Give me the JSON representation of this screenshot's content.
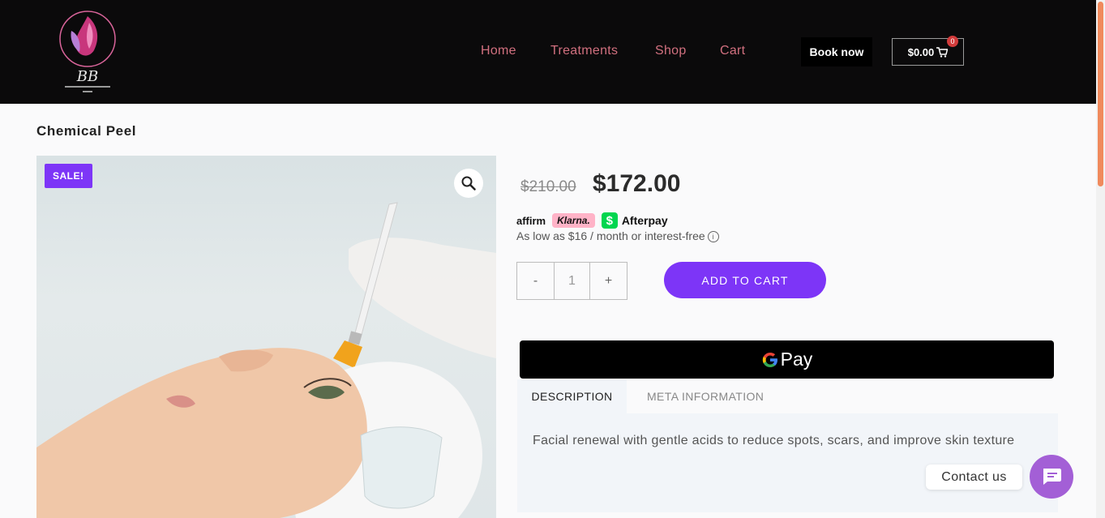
{
  "header": {
    "logo_text": "BB",
    "nav": [
      {
        "label": "Home"
      },
      {
        "label": "Treatments"
      },
      {
        "label": "Shop"
      },
      {
        "label": "Cart"
      }
    ],
    "book_now": "Book now",
    "cart_total": "$0.00",
    "cart_count": "0"
  },
  "product": {
    "title": "Chemical Peel",
    "sale_badge": "SALE!",
    "old_price": "$210.00",
    "price": "$172.00",
    "payment_logos": {
      "affirm": "affirm",
      "klarna": "Klarna.",
      "afterpay": "Afterpay"
    },
    "installment_text": "As low as $16 / month or interest-free",
    "quantity": "1",
    "qty_minus": "-",
    "qty_plus": "+",
    "add_to_cart": "ADD TO CART",
    "gpay_label": "Pay"
  },
  "tabs": [
    {
      "label": "DESCRIPTION",
      "active": true
    },
    {
      "label": "META INFORMATION",
      "active": false
    }
  ],
  "description": "Facial renewal with gentle acids to reduce spots, scars, and improve skin texture",
  "contact": {
    "label": "Contact us"
  },
  "colors": {
    "accent": "#7d35f7",
    "nav": "#d1707f",
    "header_bg": "#0b0a0b",
    "chat": "#a35fd6"
  }
}
